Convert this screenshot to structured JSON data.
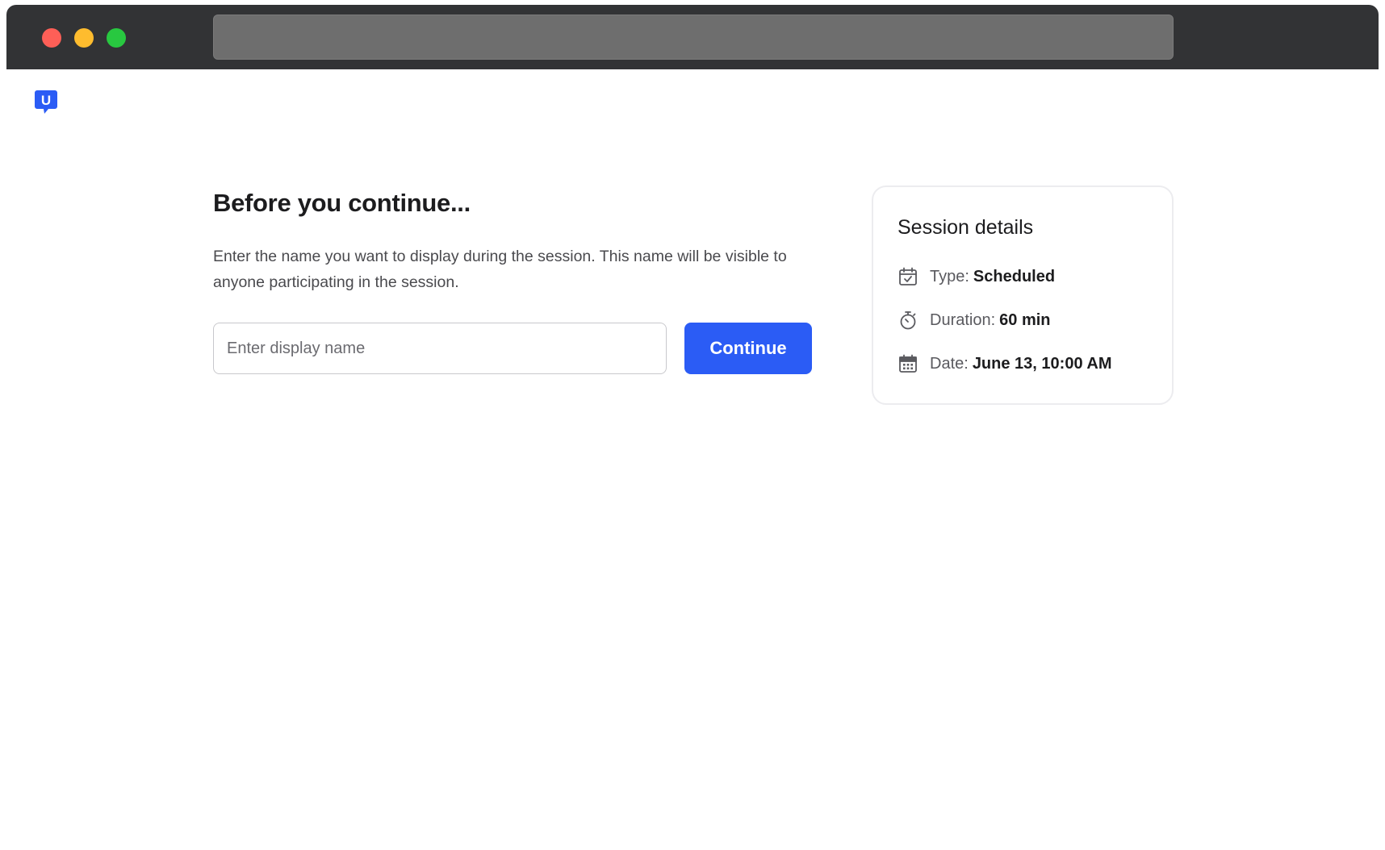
{
  "window": {
    "controls": [
      "close",
      "minimize",
      "maximize"
    ],
    "address_bar": ""
  },
  "brand": {
    "logo_icon": "usertesting-logo-icon",
    "logo_letter": "U",
    "color": "#2b5cf5"
  },
  "main": {
    "title": "Before you continue...",
    "description": "Enter the name you want to display during the session. This name will be visible to anyone participating in the session.",
    "name_input": {
      "value": "",
      "placeholder": "Enter display name"
    },
    "continue_label": "Continue"
  },
  "session_details": {
    "title": "Session details",
    "items": [
      {
        "icon": "calendar-check-icon",
        "label": "Type:",
        "value": "Scheduled"
      },
      {
        "icon": "stopwatch-icon",
        "label": "Duration:",
        "value": "60 min"
      },
      {
        "icon": "calendar-grid-icon",
        "label": "Date:",
        "value": "June 13, 10:00 AM"
      }
    ]
  },
  "colors": {
    "accent": "#2b5cf5",
    "titlebar": "#323335",
    "close": "#fe5f57",
    "minimize": "#febc2e",
    "maximize": "#28c840"
  }
}
